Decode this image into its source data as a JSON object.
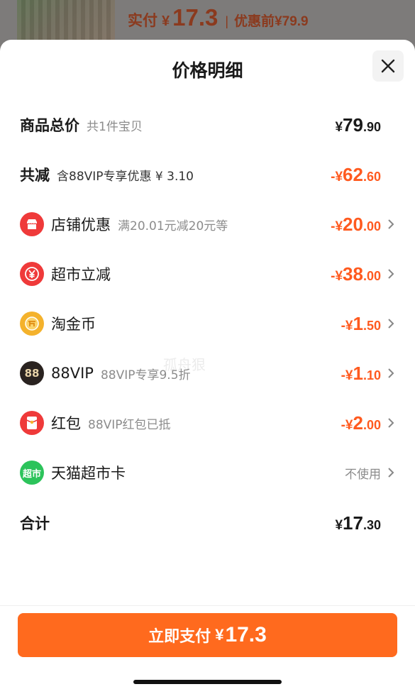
{
  "background": {
    "paid_label": "实付",
    "currency": "¥",
    "paid_value": "17.3",
    "separator": "|",
    "original_label": "优惠前",
    "original_value": "¥79.9"
  },
  "sheet": {
    "title": "价格明细",
    "watermark": "孤舟狠"
  },
  "rows": [
    {
      "name": "商品总价",
      "sub": "共1件宝贝",
      "currency": "¥",
      "int": "79",
      "dec": ".90",
      "color": "black"
    },
    {
      "name": "共减",
      "sub": "含88VIP专享优惠 ¥ 3.10",
      "currency": "-¥",
      "int": "62",
      "dec": ".60",
      "color": "orange"
    },
    {
      "name": "店铺优惠",
      "sub": "满20.01元减20元等",
      "currency": "-¥",
      "int": "20",
      "dec": ".00",
      "color": "orange",
      "icon": "shop-icon"
    },
    {
      "name": "超市立减",
      "sub": "",
      "currency": "-¥",
      "int": "38",
      "dec": ".00",
      "color": "orange",
      "icon": "yuan-coin-icon"
    },
    {
      "name": "淘金币",
      "sub": "",
      "currency": "-¥",
      "int": "1",
      "dec": ".50",
      "color": "orange",
      "icon": "gold-coin-icon"
    },
    {
      "name": "88VIP",
      "sub": "88VIP专享9.5折",
      "currency": "-¥",
      "int": "1",
      "dec": ".10",
      "color": "orange",
      "icon": "vip-88-icon"
    },
    {
      "name": "红包",
      "sub": "88VIP红包已抵",
      "currency": "-¥",
      "int": "2",
      "dec": ".00",
      "color": "orange",
      "icon": "red-packet-icon"
    },
    {
      "name": "天猫超市卡",
      "status": "不使用",
      "icon": "supermarket-card-icon",
      "icon_text": "超市"
    },
    {
      "name": "合计",
      "currency": "¥",
      "int": "17",
      "dec": ".30",
      "color": "black"
    }
  ],
  "pay_button": {
    "label": "立即支付",
    "currency": "¥",
    "value": "17.3"
  },
  "colors": {
    "accent": "#ff6a1e",
    "discount": "#ff5a1f",
    "text": "#1a1a1a",
    "muted": "#8c8c8c"
  }
}
